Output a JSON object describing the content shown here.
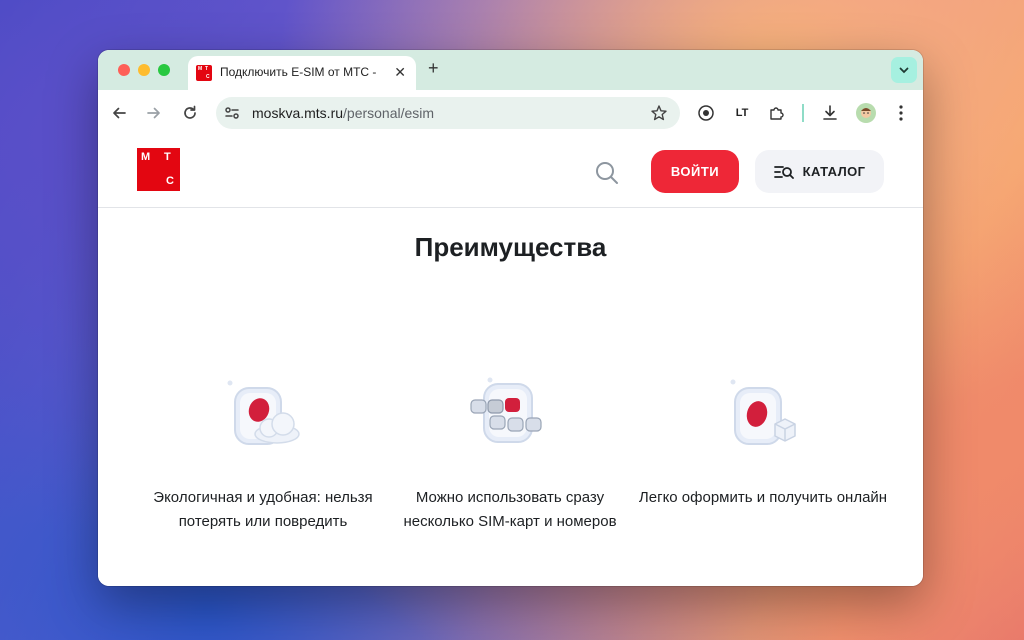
{
  "browser": {
    "tab": {
      "title": "Подключить E-SIM от МТС -",
      "favicon_letters": [
        "М",
        "Т",
        "С"
      ]
    },
    "new_tab_label": "+",
    "tab_close_label": "✕",
    "address": {
      "host": "moskva.mts.ru",
      "path": "/personal/esim"
    },
    "extension_labels": {
      "lt": "LT"
    }
  },
  "site": {
    "logo_letters": [
      "М",
      "Т",
      "С"
    ],
    "login_label": "ВОЙТИ",
    "catalog_label": "КАТАЛОГ",
    "brand_color": "#e30611",
    "accent_color": "#ee2737"
  },
  "advantages": {
    "title": "Преимущества",
    "items": [
      {
        "icon": "esim-cloud-icon",
        "text": "Экологичная и удобная: нельзя потерять или повредить"
      },
      {
        "icon": "esim-multiple-sims-icon",
        "text": "Можно использовать сразу несколько SIM-карт и номеров"
      },
      {
        "icon": "esim-cube-icon",
        "text": "Легко оформить и получить онлайн"
      }
    ]
  }
}
